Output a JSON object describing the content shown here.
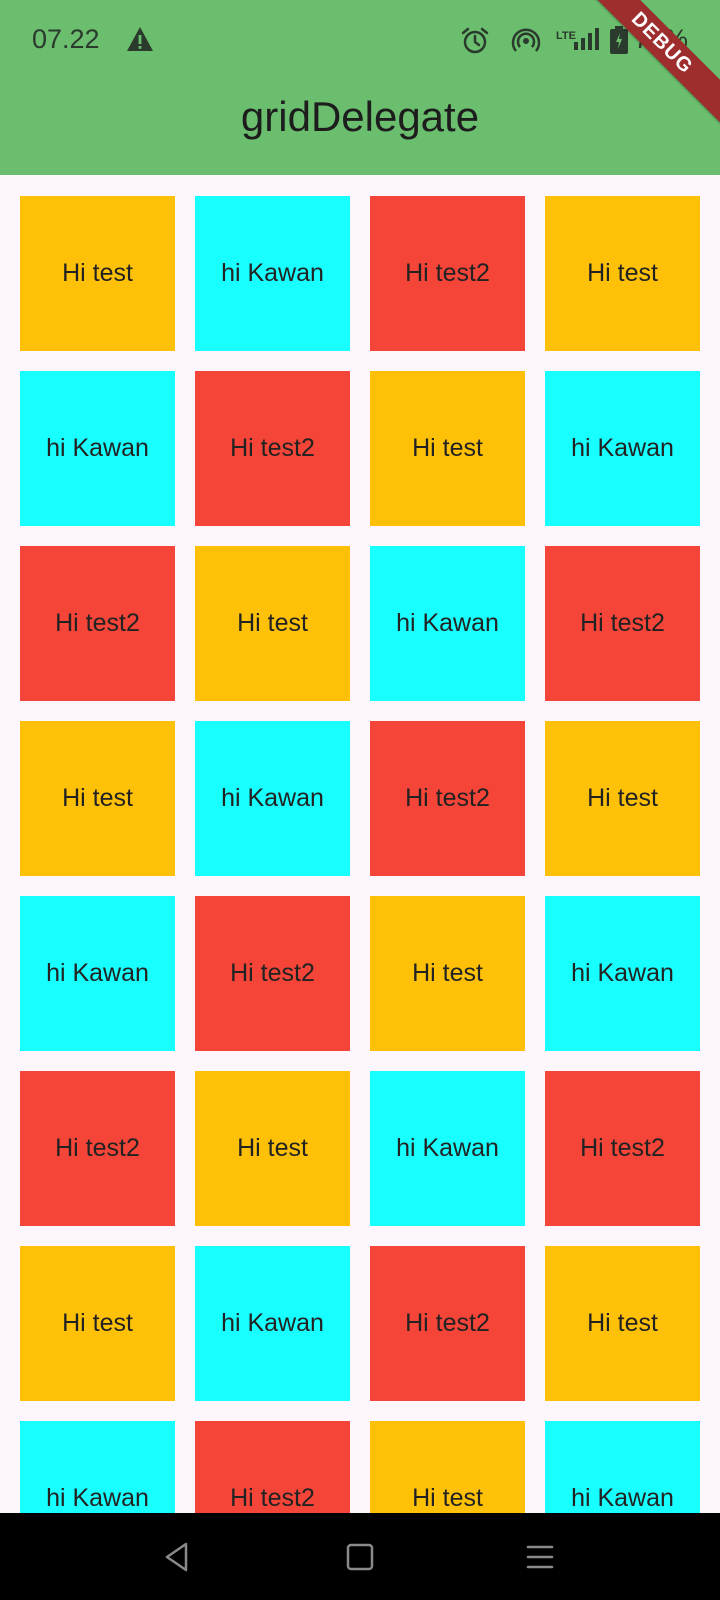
{
  "status_bar": {
    "time": "07.22",
    "lte": "LTE",
    "battery": "73%",
    "icons": [
      "warning-icon",
      "alarm-icon",
      "hotspot-icon",
      "signal-icon",
      "battery-icon"
    ]
  },
  "app_bar": {
    "title": "gridDelegate",
    "debug_label": "DEBUG",
    "color": "#6abe6e"
  },
  "colors": {
    "amber": "#ffc107",
    "cyan": "#18ffff",
    "red": "#f44538"
  },
  "grid": {
    "tiles": [
      {
        "label": "Hi test",
        "color": "#ffc107"
      },
      {
        "label": "hi Kawan",
        "color": "#18ffff"
      },
      {
        "label": "Hi test2",
        "color": "#f44538"
      },
      {
        "label": "Hi test",
        "color": "#ffc107"
      },
      {
        "label": "hi Kawan",
        "color": "#18ffff"
      },
      {
        "label": "Hi test2",
        "color": "#f44538"
      },
      {
        "label": "Hi test",
        "color": "#ffc107"
      },
      {
        "label": "hi Kawan",
        "color": "#18ffff"
      },
      {
        "label": "Hi test2",
        "color": "#f44538"
      },
      {
        "label": "Hi test",
        "color": "#ffc107"
      },
      {
        "label": "hi Kawan",
        "color": "#18ffff"
      },
      {
        "label": "Hi test2",
        "color": "#f44538"
      },
      {
        "label": "Hi test",
        "color": "#ffc107"
      },
      {
        "label": "hi Kawan",
        "color": "#18ffff"
      },
      {
        "label": "Hi test2",
        "color": "#f44538"
      },
      {
        "label": "Hi test",
        "color": "#ffc107"
      },
      {
        "label": "hi Kawan",
        "color": "#18ffff"
      },
      {
        "label": "Hi test2",
        "color": "#f44538"
      },
      {
        "label": "Hi test",
        "color": "#ffc107"
      },
      {
        "label": "hi Kawan",
        "color": "#18ffff"
      },
      {
        "label": "Hi test2",
        "color": "#f44538"
      },
      {
        "label": "Hi test",
        "color": "#ffc107"
      },
      {
        "label": "hi Kawan",
        "color": "#18ffff"
      },
      {
        "label": "Hi test2",
        "color": "#f44538"
      },
      {
        "label": "Hi test",
        "color": "#ffc107"
      },
      {
        "label": "hi Kawan",
        "color": "#18ffff"
      },
      {
        "label": "Hi test2",
        "color": "#f44538"
      },
      {
        "label": "Hi test",
        "color": "#ffc107"
      },
      {
        "label": "hi Kawan",
        "color": "#18ffff"
      },
      {
        "label": "Hi test2",
        "color": "#f44538"
      },
      {
        "label": "Hi test",
        "color": "#ffc107"
      },
      {
        "label": "hi Kawan",
        "color": "#18ffff"
      }
    ]
  },
  "nav_bar": {
    "icons": [
      "back-icon",
      "home-icon",
      "menu-icon"
    ]
  }
}
